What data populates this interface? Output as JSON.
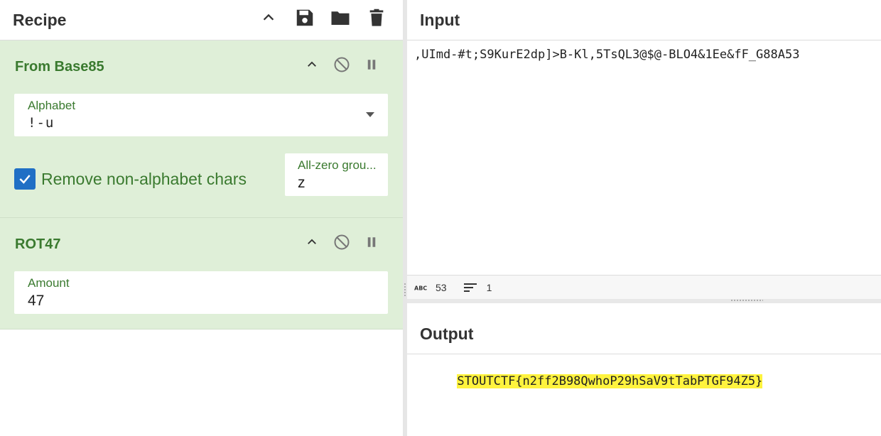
{
  "recipe": {
    "title": "Recipe",
    "header_icons": [
      "chevron-up-icon",
      "save-icon",
      "folder-icon",
      "trash-icon"
    ]
  },
  "operations": [
    {
      "title": "From Base85",
      "fields": {
        "alphabet": {
          "label": "Alphabet",
          "value": "!-u"
        },
        "remove_non_alphabet": {
          "label": "Remove non-alphabet chars",
          "checked": true
        },
        "all_zero_group": {
          "label": "All-zero grou...",
          "value": "z"
        }
      }
    },
    {
      "title": "ROT47",
      "fields": {
        "amount": {
          "label": "Amount",
          "value": "47"
        }
      }
    }
  ],
  "input": {
    "title": "Input",
    "text": ",UImd-#t;S9KurE2dp]>B-Kl,5TsQL3@$@-BLO4&1Ee&fF_G88A53",
    "status": {
      "length": "53",
      "lines": "1"
    }
  },
  "output": {
    "title": "Output",
    "text": "STOUTCTF{n2ff2B98QwhoP29hSaV9tTabPTGF94Z5}"
  },
  "colors": {
    "op_background": "#dfefd8",
    "op_text": "#3a7a2f",
    "checkbox": "#1f6fc5",
    "highlight": "#fff33e"
  }
}
